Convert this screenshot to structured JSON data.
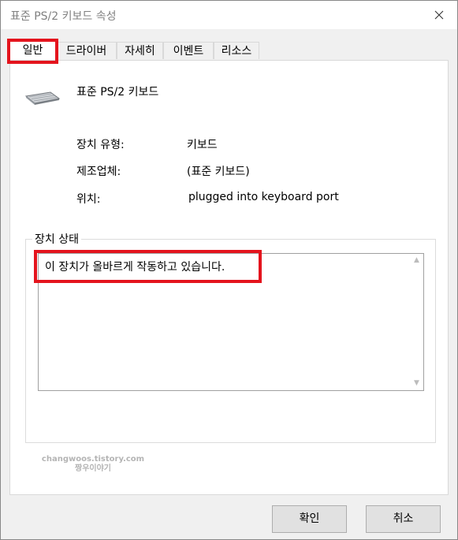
{
  "window": {
    "title": "표준 PS/2 키보드 속성"
  },
  "tabs": [
    {
      "label": "일반",
      "active": true
    },
    {
      "label": "드라이버"
    },
    {
      "label": "자세히"
    },
    {
      "label": "이벤트"
    },
    {
      "label": "리소스"
    }
  ],
  "device": {
    "name": "표준 PS/2 키보드",
    "icon": "keyboard-icon",
    "properties": [
      {
        "label": "장치 유형:",
        "value": "키보드"
      },
      {
        "label": "제조업체:",
        "value": "(표준 키보드)"
      },
      {
        "label": "위치:",
        "value": "plugged into keyboard port"
      }
    ]
  },
  "status": {
    "group_title": "장치 상태",
    "text": "이 장치가 올바르게 작동하고 있습니다."
  },
  "watermark": {
    "line1": "changwoos.tistory.com",
    "line2": "짱우이야기"
  },
  "buttons": {
    "ok": "확인",
    "cancel": "취소"
  },
  "colors": {
    "highlight": "#e4141d",
    "title_text": "#808080"
  }
}
